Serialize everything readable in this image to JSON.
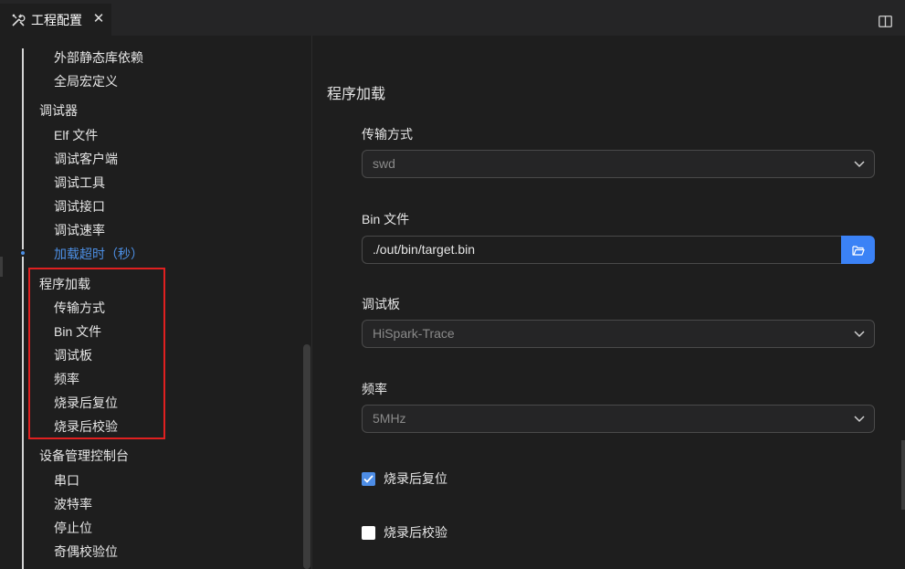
{
  "tab": {
    "title": "工程配置",
    "close": "✕"
  },
  "sidebar": {
    "items": [
      {
        "label": "外部静态库依赖",
        "level": "child"
      },
      {
        "label": "全局宏定义",
        "level": "child"
      },
      {
        "label": "调试器",
        "level": "group"
      },
      {
        "label": "Elf 文件",
        "level": "child"
      },
      {
        "label": "调试客户端",
        "level": "child"
      },
      {
        "label": "调试工具",
        "level": "child"
      },
      {
        "label": "调试接口",
        "level": "child"
      },
      {
        "label": "调试速率",
        "level": "child"
      },
      {
        "label": "加载超时（秒）",
        "level": "child",
        "active": true
      },
      {
        "label": "程序加载",
        "level": "group"
      },
      {
        "label": "传输方式",
        "level": "child"
      },
      {
        "label": "Bin 文件",
        "level": "child"
      },
      {
        "label": "调试板",
        "level": "child"
      },
      {
        "label": "频率",
        "level": "child"
      },
      {
        "label": "烧录后复位",
        "level": "child"
      },
      {
        "label": "烧录后校验",
        "level": "child"
      },
      {
        "label": "设备管理控制台",
        "level": "group"
      },
      {
        "label": "串口",
        "level": "child"
      },
      {
        "label": "波特率",
        "level": "child"
      },
      {
        "label": "停止位",
        "level": "child"
      },
      {
        "label": "奇偶校验位",
        "level": "child"
      }
    ]
  },
  "content": {
    "section_title": "程序加载",
    "transfer": {
      "label": "传输方式",
      "value": "swd"
    },
    "bin": {
      "label": "Bin 文件",
      "value": "./out/bin/target.bin"
    },
    "board": {
      "label": "调试板",
      "value": "HiSpark-Trace"
    },
    "freq": {
      "label": "频率",
      "value": "5MHz"
    },
    "reset_after_burn": {
      "label": "烧录后复位",
      "checked": true
    },
    "verify_after_burn": {
      "label": "烧录后校验",
      "checked": false
    }
  },
  "colors": {
    "accent": "#4d90e6",
    "highlight_box": "#e02020",
    "button": "#3b82f6"
  }
}
